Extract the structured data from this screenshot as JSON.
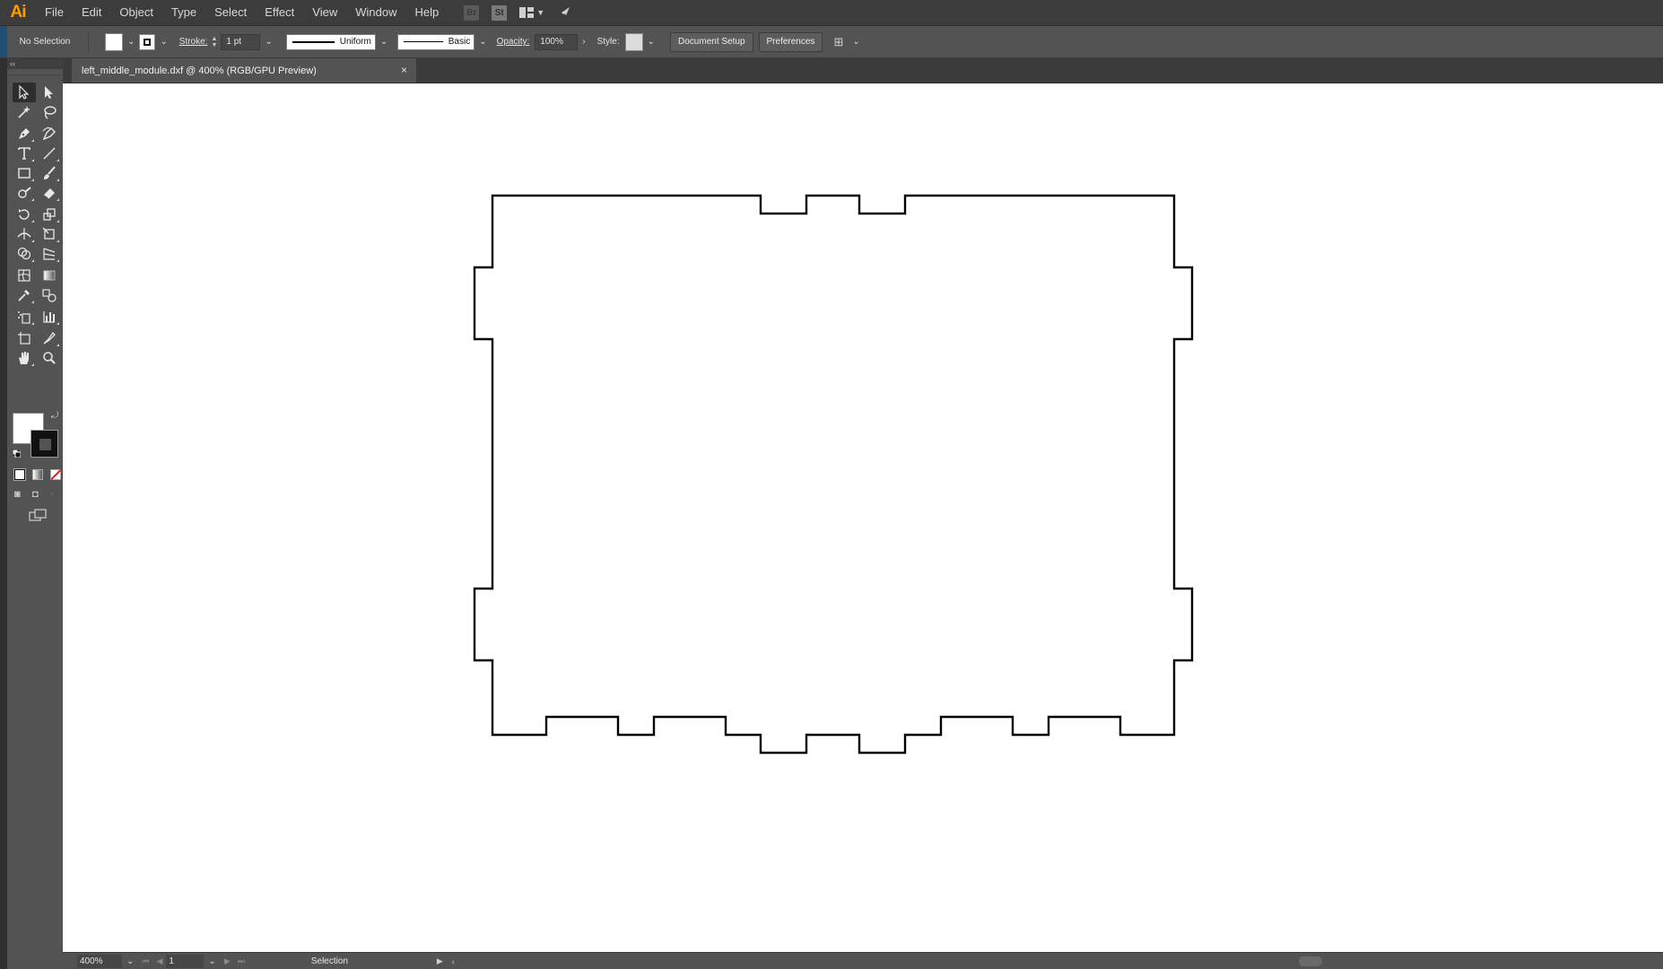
{
  "app": {
    "logo": "Ai",
    "accent": "#ff9a00"
  },
  "menu": {
    "items": [
      "File",
      "Edit",
      "Object",
      "Type",
      "Select",
      "Effect",
      "View",
      "Window",
      "Help"
    ],
    "icons": {
      "bridge": "Br",
      "stock": "St"
    }
  },
  "control": {
    "selection_status": "No Selection",
    "stroke_label": "Stroke:",
    "stroke_weight": "1 pt",
    "profile_uniform": "Uniform",
    "brush_basic": "Basic",
    "opacity_label": "Opacity:",
    "opacity_value": "100%",
    "style_label": "Style:",
    "document_setup": "Document Setup",
    "preferences": "Preferences"
  },
  "tab": {
    "title": "left_middle_module.dxf @ 400% (RGB/GPU Preview)",
    "close": "×"
  },
  "tools": {
    "collapse": "‹‹"
  },
  "status": {
    "zoom": "400%",
    "page": "1",
    "tool": "Selection"
  },
  "colors": {
    "menubar": "#3c3c3c",
    "panel": "#535353",
    "canvas": "#ffffff",
    "artwork_stroke": "#000000"
  }
}
